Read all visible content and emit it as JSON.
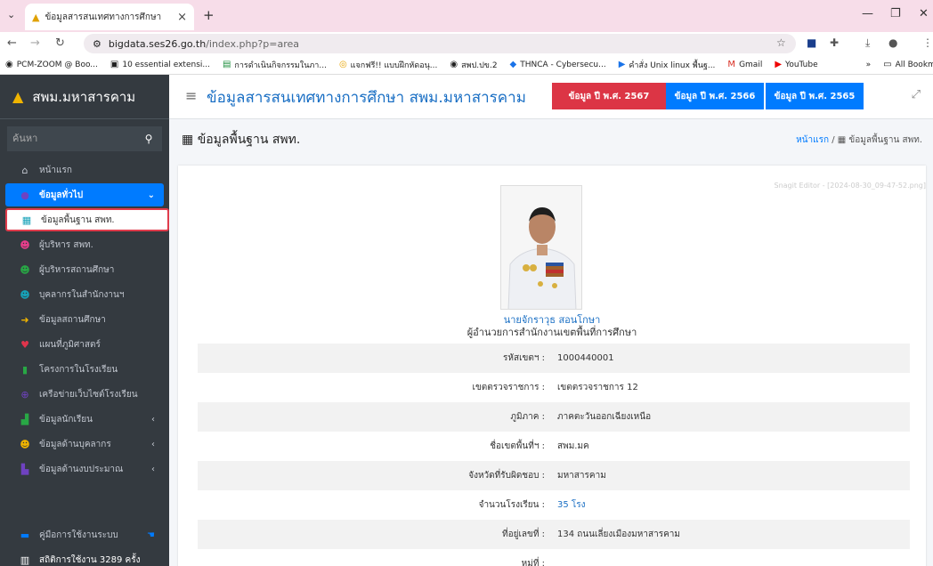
{
  "browser": {
    "tab_title": "ข้อมูลสารสนเทศทางการศึกษา",
    "url_host": "bigdata.ses26.go.th",
    "url_path": "/index.php?p=area",
    "bookmarks": [
      {
        "icon": "globe-icon",
        "label": "PCM-ZOOM @ Boo..."
      },
      {
        "icon": "extension-icon",
        "label": "10 essential extensi..."
      },
      {
        "icon": "doc-icon",
        "label": "การดำเนินกิจกรรมในภา..."
      },
      {
        "icon": "fox-icon",
        "label": "แจกฟรี!! แบบฝึกหัดอนุ..."
      },
      {
        "icon": "globe-icon",
        "label": "สพป.ปข.2"
      },
      {
        "icon": "shield-icon",
        "label": "THNCA - Cybersecu..."
      },
      {
        "icon": "terminal-icon",
        "label": "คำสั่ง Unix linux พื้นฐ..."
      },
      {
        "icon": "gmail-icon",
        "label": "Gmail"
      },
      {
        "icon": "youtube-icon",
        "label": "YouTube"
      }
    ],
    "more_bookmarks": "»",
    "all_bookmarks": "All Bookmarks"
  },
  "sidebar": {
    "brand": "สพม.มหาสารคาม",
    "search_placeholder": "ค้นหา",
    "items": [
      {
        "icon": "home-icon",
        "label": "หน้าแรก",
        "state": "normal"
      },
      {
        "icon": "info-circle-icon",
        "label": "ข้อมูลทั่วไป",
        "state": "active",
        "chevron": "⌄"
      },
      {
        "icon": "table-icon",
        "label": "ข้อมูลพื้นฐาน สพท.",
        "state": "sub"
      },
      {
        "icon": "users-icon",
        "label": "ผู้บริหาร สพท.",
        "state": "normal"
      },
      {
        "icon": "users-icon",
        "label": "ผู้บริหารสถานศึกษา",
        "state": "normal"
      },
      {
        "icon": "users-icon",
        "label": "บุคลากรในสำนักงานฯ",
        "state": "normal"
      },
      {
        "icon": "arrow-circle-icon",
        "label": "ข้อมูลสถานศึกษา",
        "state": "normal"
      },
      {
        "icon": "map-pin-icon",
        "label": "แผนที่ภูมิศาสตร์",
        "state": "normal"
      },
      {
        "icon": "file-icon",
        "label": "โครงการในโรงเรียน",
        "state": "normal"
      },
      {
        "icon": "globe-icon",
        "label": "เครือข่ายเว็บไซต์โรงเรียน",
        "state": "normal"
      },
      {
        "icon": "chart-icon",
        "label": "ข้อมูลนักเรียน",
        "state": "normal",
        "chevron": "‹"
      },
      {
        "icon": "users-icon",
        "label": "ข้อมูลด้านบุคลากร",
        "state": "normal",
        "chevron": "‹"
      },
      {
        "icon": "bar-chart-icon",
        "label": "ข้อมูลด้านงบประมาณ",
        "state": "normal",
        "chevron": "‹"
      }
    ],
    "manual_label": "คู่มือการใช้งานระบบ",
    "stats_label": "สถิติการใช้งาน 3289 ครั้ง"
  },
  "header": {
    "title": "ข้อมูลสารสนเทศทางการศึกษา สพม.มหาสารคาม",
    "year_buttons": [
      {
        "label": "ข้อมูล ปี พ.ศ. 2567",
        "color": "#dc3545"
      },
      {
        "label": "ข้อมูล ปี พ.ศ. 2566",
        "color": "#007bff"
      },
      {
        "label": "ข้อมูล ปี พ.ศ. 2565",
        "color": "#007bff"
      }
    ]
  },
  "content": {
    "page_title": "ข้อมูลพื้นฐาน สพท.",
    "breadcrumb_home": "หน้าแรก",
    "breadcrumb_sep": "/",
    "breadcrumb_current": "ข้อมูลพื้นฐาน สพท.",
    "watermark": "Snagit Editor - [2024-08-30_09-47-52.png]",
    "person_name": "นายจักราวุธ สอนโกษา",
    "person_role": "ผู้อำนวยการสำนักงานเขตพื้นที่การศึกษา",
    "rows": [
      {
        "label": "รหัสเขตฯ :",
        "value": "1000440001"
      },
      {
        "label": "เขตตรวจราชการ :",
        "value": "เขตตรวจราชการ 12"
      },
      {
        "label": "ภูมิภาค :",
        "value": "ภาคตะวันออกเฉียงเหนือ"
      },
      {
        "label": "ชื่อเขตพื้นที่ฯ :",
        "value": "สพม.มค"
      },
      {
        "label": "จังหวัดที่รับผิดชอบ :",
        "value": "มหาสารคาม"
      },
      {
        "label": "จำนวนโรงเรียน :",
        "value": "35 โรง",
        "link": true
      },
      {
        "label": "ที่อยู่เลขที่ :",
        "value": "134 ถนนเลี่ยงเมืองมหาสารคาม"
      },
      {
        "label": "หมู่ที่ :",
        "value": ""
      }
    ]
  }
}
